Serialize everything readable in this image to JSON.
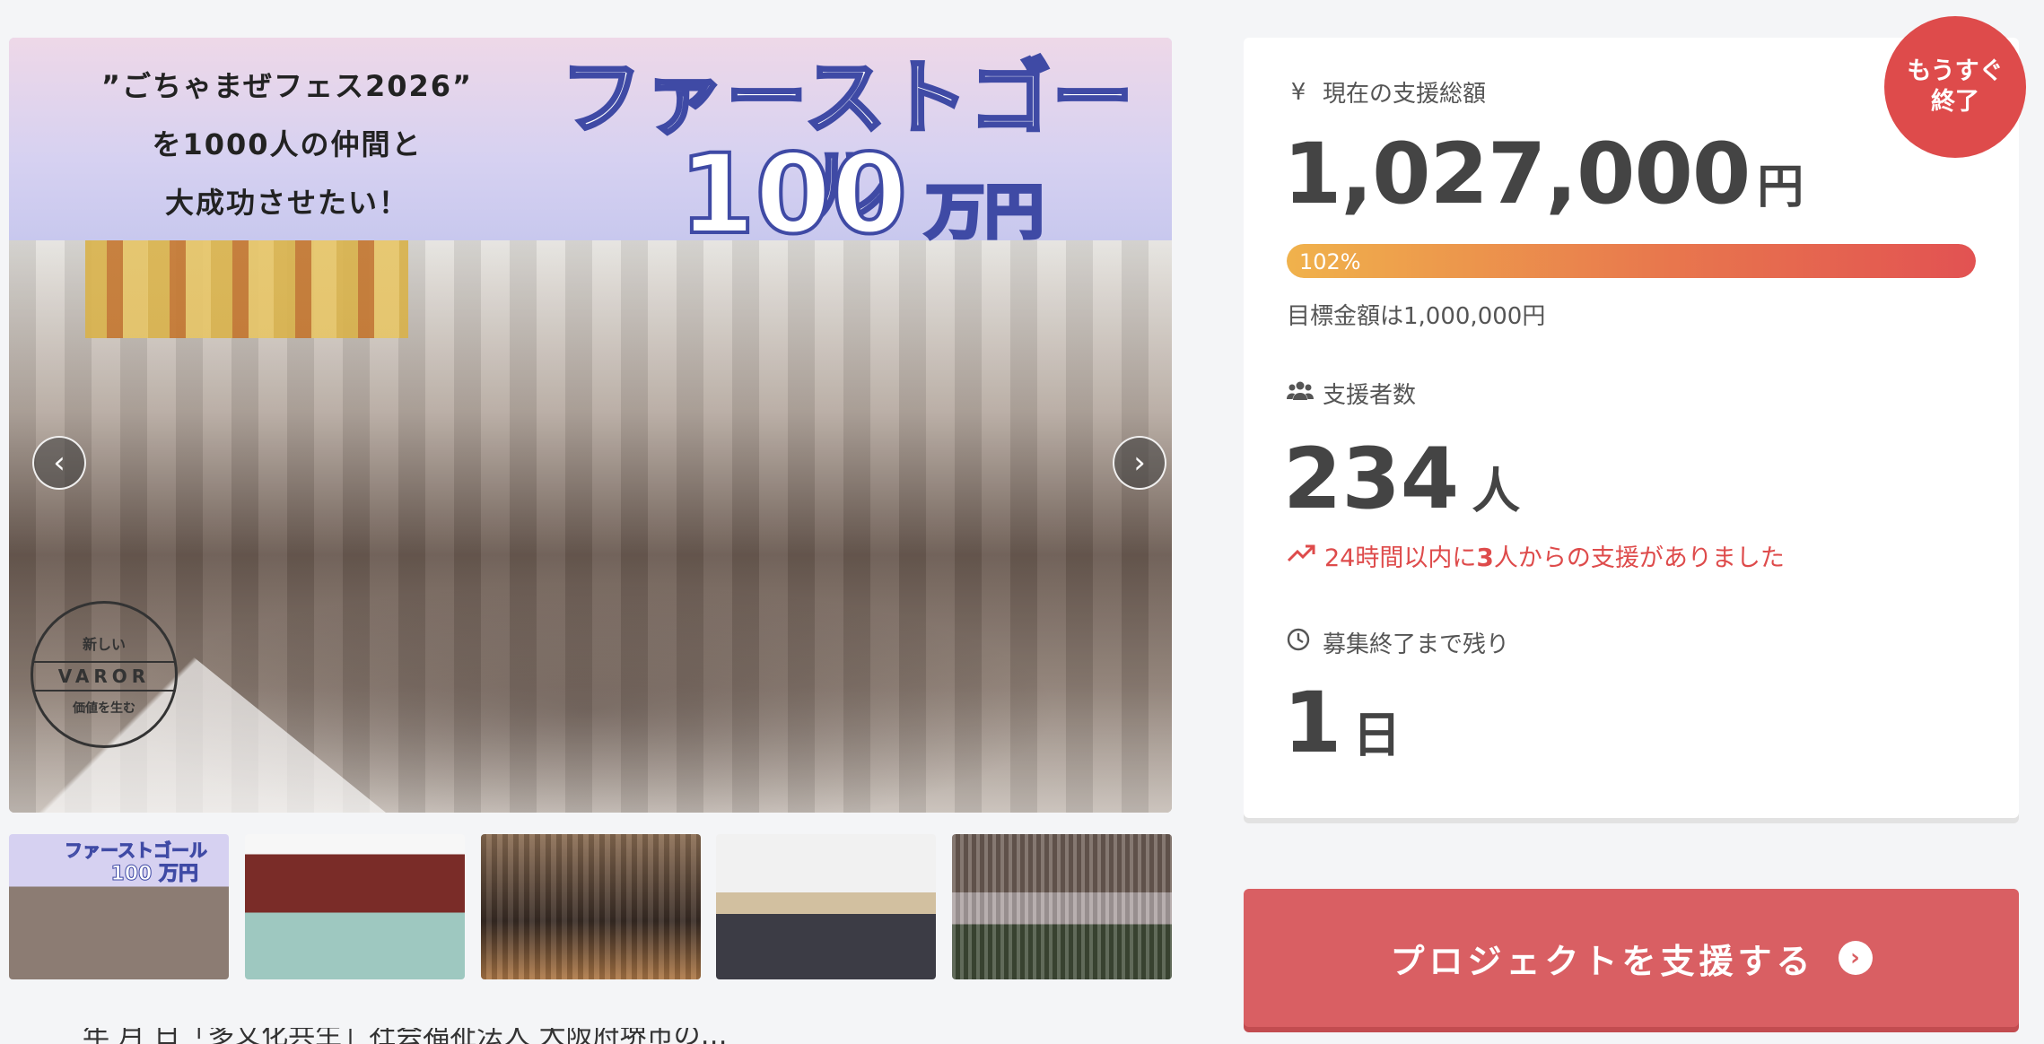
{
  "hero": {
    "tagline_lines": [
      "”ごちゃまぜフェス2026”",
      "を1000人の仲間と",
      "大成功させたい！"
    ],
    "goal_title": "ファーストゴール",
    "goal_amount": "100",
    "goal_unit": "万円",
    "logo": {
      "top": "新しい",
      "mid": "VAROR",
      "bottom": "価値を生む"
    },
    "prev_icon": "chevron-left-icon",
    "next_icon": "chevron-right-icon"
  },
  "thumbnails": {
    "first_label_title": "ファーストゴール",
    "first_label_amount": "100 万円"
  },
  "body_snippet": "　　年 月  日「多文化共生」社会福祉法人 大阪府堺市の…",
  "badge": {
    "line1": "もうすぐ",
    "line2": "終了"
  },
  "stats": {
    "total_label": "現在の支援総額",
    "total_icon": "yen-icon",
    "total_value": "1,027,000",
    "total_unit": "円",
    "progress_percent": 102,
    "progress_text": "102%",
    "goal_text": "目標金額は1,000,000円",
    "supporters_label": "支援者数",
    "supporters_icon": "users-icon",
    "supporters_value": "234",
    "supporters_unit": "人",
    "recent_prefix": "24時間以内に",
    "recent_count": "3",
    "recent_suffix": "人からの支援がありました",
    "recent_icon": "trending-up-icon",
    "remaining_label": "募集終了まで残り",
    "remaining_icon": "clock-icon",
    "remaining_value": "1",
    "remaining_unit": "日"
  },
  "cta": {
    "label": "プロジェクトを支援する",
    "icon": "arrow-right-circle-icon"
  },
  "colors": {
    "accent": "#de4b4b",
    "cta": "#d95f63",
    "goal_text": "#3f4aa5"
  }
}
